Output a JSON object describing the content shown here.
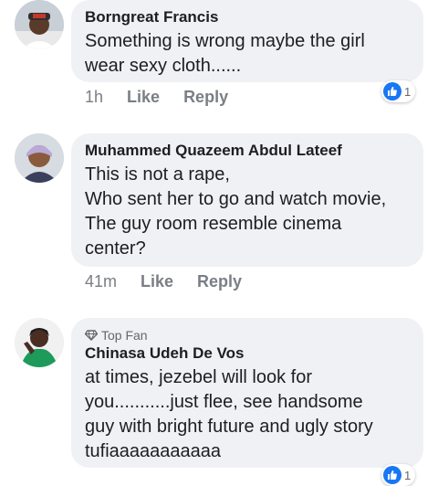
{
  "comments": [
    {
      "author": "Borngreat Francis",
      "text": "Something is wrong maybe the girl\nwear sexy cloth......",
      "time": "1h",
      "like_label": "Like",
      "reply_label": "Reply",
      "reaction_count": "1",
      "top_fan": ""
    },
    {
      "author": "Muhammed Quazeem Abdul Lateef",
      "text": "This is not a rape,\nWho sent her to go and watch movie,\nThe guy room resemble cinema\ncenter?",
      "time": "41m",
      "like_label": "Like",
      "reply_label": "Reply",
      "top_fan": ""
    },
    {
      "author": "Chinasa Udeh De Vos",
      "top_fan": "Top Fan",
      "text": "at times, jezebel will look for\nyou...........just flee, see handsome\nguy with bright future and ugly story\ntufiaaaaaaaaaaa",
      "reaction_count": "1"
    }
  ],
  "colors": {
    "bubble": "#eff1f4",
    "like_blue": "#1877f2",
    "meta_gray": "#7a7e85"
  }
}
